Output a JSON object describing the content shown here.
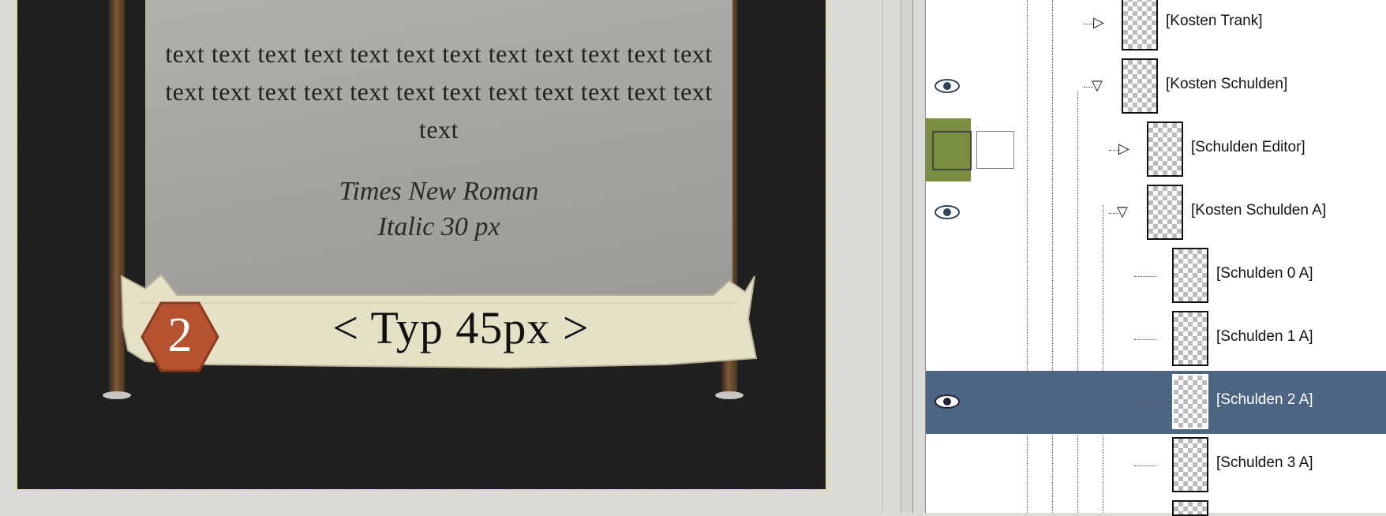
{
  "card": {
    "body_text": "text text text text text text text text text text text text text text text text text text text text text text text text text",
    "font_line1": "Times New Roman",
    "font_line2": "Italic 30 px",
    "type_label": "< Typ 45px >",
    "cost_value": "2"
  },
  "layers": {
    "rows": [
      {
        "name": "[Kosten Trank]",
        "visible": false,
        "expander": "collapsed"
      },
      {
        "name": "[Kosten Schulden]",
        "visible": true,
        "expander": "expanded"
      },
      {
        "name": "[Schulden Editor]",
        "visible": false,
        "expander": "collapsed"
      },
      {
        "name": "[Kosten Schulden A]",
        "visible": true,
        "expander": "expanded"
      },
      {
        "name": "[Schulden 0 A]",
        "visible": false,
        "expander": "none"
      },
      {
        "name": "[Schulden 1 A]",
        "visible": false,
        "expander": "none"
      },
      {
        "name": "[Schulden 2 A]",
        "visible": true,
        "expander": "none",
        "selected": true
      },
      {
        "name": "[Schulden 3 A]",
        "visible": false,
        "expander": "none"
      }
    ]
  },
  "colors": {
    "selection": "#4d6482",
    "foreground_swatch": "#7a8e40",
    "background_swatch": "#ffffff",
    "cost_badge": "#b5522f"
  },
  "icons": {
    "visibility": "eye-icon",
    "expand": "triangle-right-icon",
    "collapse": "triangle-down-icon"
  }
}
